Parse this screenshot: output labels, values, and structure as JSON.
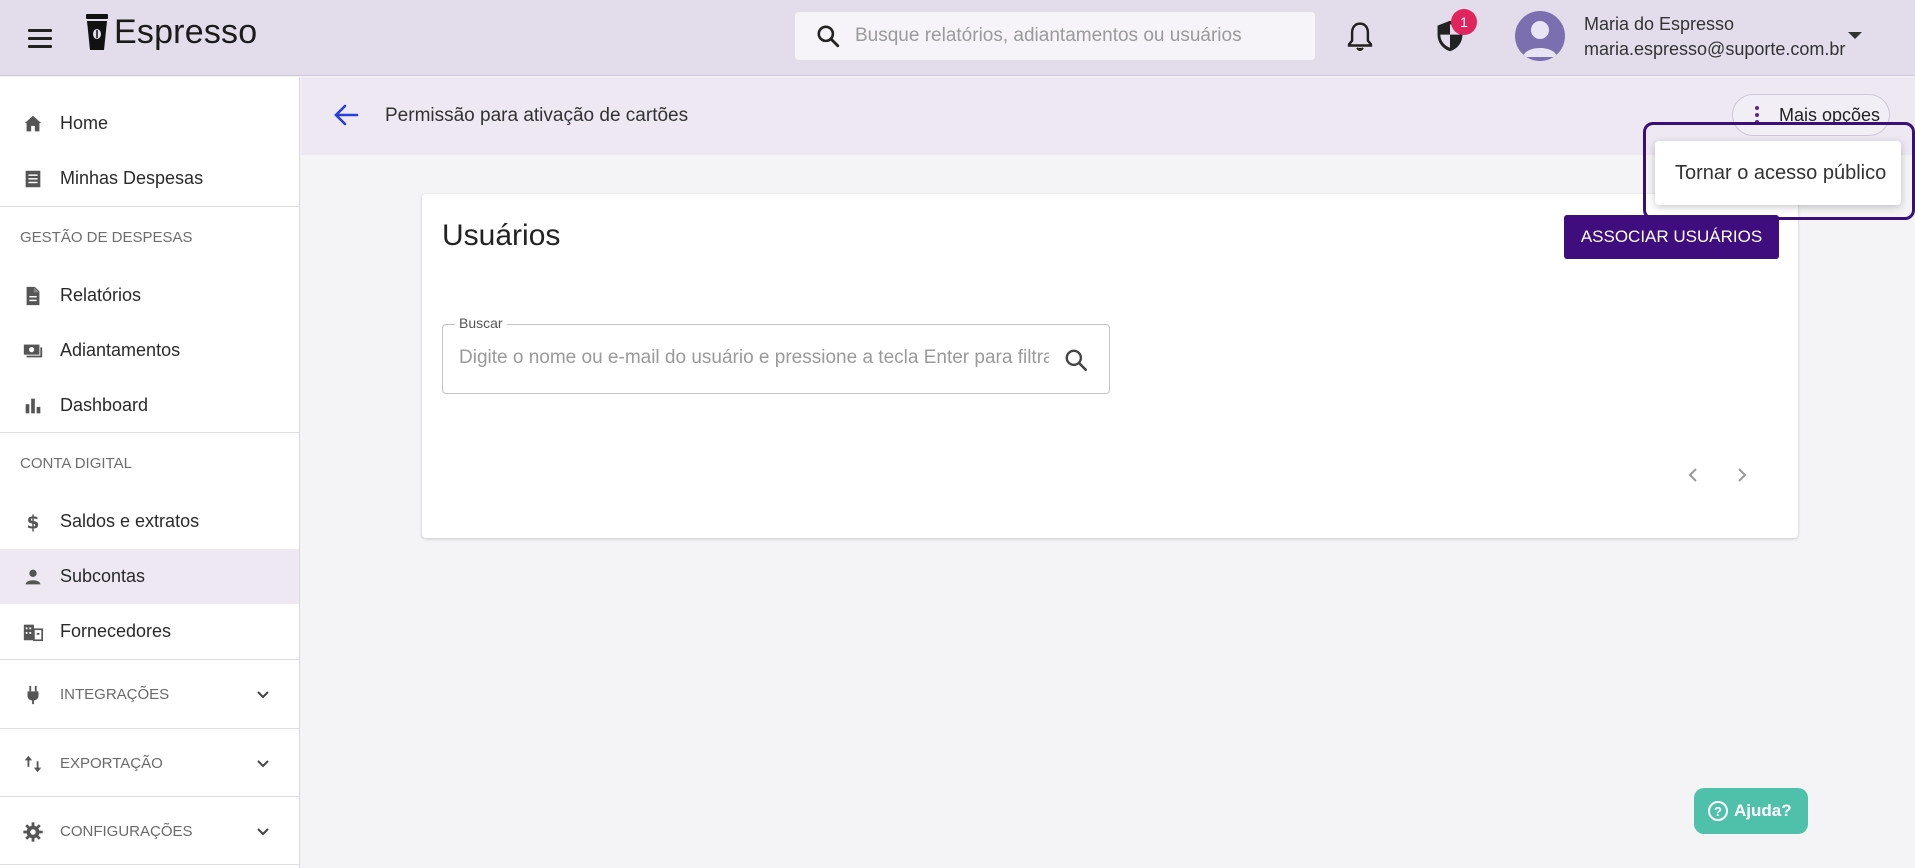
{
  "app": {
    "brand": "Espresso",
    "search_placeholder": "Busque relatórios, adiantamentos ou usuários",
    "notifications_badge": "1",
    "user": {
      "name": "Maria do Espresso",
      "email": "maria.espresso@suporte.com.br"
    }
  },
  "sidebar": {
    "items": [
      {
        "label": "Home",
        "icon": "home-icon"
      },
      {
        "label": "Minhas Despesas",
        "icon": "receipt-icon"
      }
    ],
    "section1": "GESTÃO DE DESPESAS",
    "section1_items": [
      {
        "label": "Relatórios",
        "icon": "document-icon"
      },
      {
        "label": "Adiantamentos",
        "icon": "cash-icon"
      },
      {
        "label": "Dashboard",
        "icon": "bar-chart-icon"
      }
    ],
    "section2": "CONTA DIGITAL",
    "section2_items": [
      {
        "label": "Saldos e extratos",
        "icon": "dollar-icon"
      },
      {
        "label": "Subcontas",
        "icon": "person-icon"
      },
      {
        "label": "Fornecedores",
        "icon": "building-icon"
      }
    ],
    "groups": [
      {
        "label": "INTEGRAÇÕES",
        "icon": "plug-icon"
      },
      {
        "label": "EXPORTAÇÃO",
        "icon": "import-export-icon"
      },
      {
        "label": "CONFIGURAÇÕES",
        "icon": "gear-icon"
      }
    ],
    "active": "Subcontas"
  },
  "header": {
    "title": "Permissão para ativação de cartões",
    "more_options": "Mais opções"
  },
  "menu": {
    "item": "Tornar o acesso público"
  },
  "card": {
    "title": "Usuários",
    "associate_button": "ASSOCIAR USUÁRIOS",
    "search_label": "Buscar",
    "search_placeholder": "Digite o nome ou e-mail do usuário e pressione a tecla Enter para filtrar"
  },
  "help": {
    "label": "Ajuda?"
  },
  "colors": {
    "topbar": "#e3dceb",
    "accent": "#3f0d7d",
    "help": "#4fc1ab",
    "badge": "#e0245e"
  }
}
